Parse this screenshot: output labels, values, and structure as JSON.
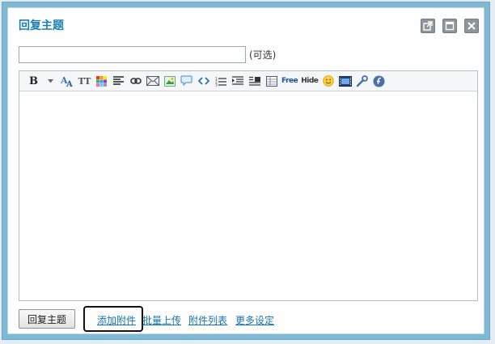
{
  "dialog": {
    "title": "回复主题"
  },
  "window_buttons": [
    {
      "name": "popout-icon"
    },
    {
      "name": "maximize-icon"
    },
    {
      "name": "close-icon"
    }
  ],
  "subject": {
    "value": "",
    "optional_label": "(可选)"
  },
  "toolbar": {
    "bold_label": "B",
    "font_size_label": "TT",
    "free_label": "Free",
    "hide_label": "Hide",
    "icons": [
      "bold-icon",
      "font-dropdown-icon",
      "font-color-icon",
      "font-size-icon",
      "color-palette-icon",
      "align-icon",
      "link-icon",
      "email-icon",
      "image-icon",
      "quote-icon",
      "code-icon",
      "ordered-list-icon",
      "indent-icon",
      "float-icon",
      "table-icon",
      "free-icon",
      "hide-icon",
      "smiley-icon",
      "media-icon",
      "tools-icon",
      "flash-icon"
    ]
  },
  "editor": {
    "content": ""
  },
  "footer": {
    "reply_button": "回复主题",
    "add_attachment": "添加附件",
    "bulk_upload": "批量上传",
    "attachment_list": "附件列表",
    "more_settings": "更多设定"
  }
}
